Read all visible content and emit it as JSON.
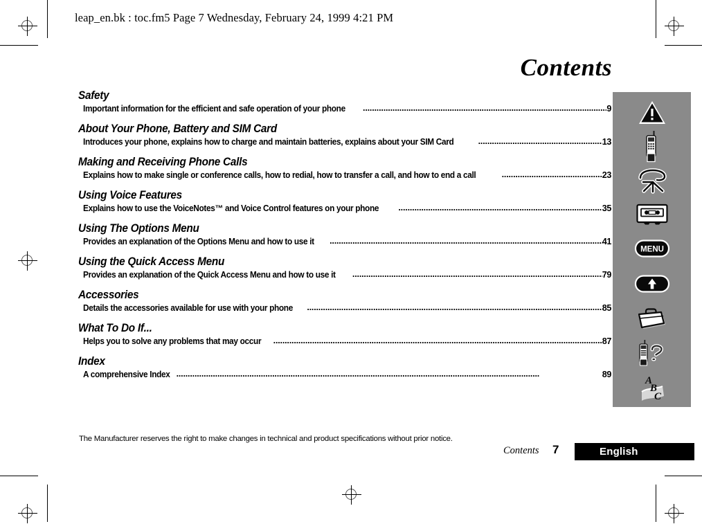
{
  "file_header": "leap_en.bk : toc.fm5  Page 7  Wednesday, February 24, 1999  4:21 PM",
  "page_title": "Contents",
  "toc": {
    "entries": [
      {
        "heading": "Safety",
        "description": "Important information for the efficient and safe operation of your phone",
        "page": "9"
      },
      {
        "heading": "About Your Phone, Battery and SIM Card",
        "description": "Introduces your phone, explains how to charge and maintain batteries, explains about your SIM Card",
        "page": "13"
      },
      {
        "heading": "Making and Receiving Phone Calls",
        "description": "Explains how to make single or conference calls, how to redial, how to transfer a call, and how to end a call",
        "page": "23"
      },
      {
        "heading": "Using Voice Features",
        "description": "Explains how to use the VoiceNotes™ and Voice Control features on your phone",
        "page": "35"
      },
      {
        "heading": "Using The Options Menu",
        "description": "Provides an explanation of the Options Menu and how to use it",
        "page": "41"
      },
      {
        "heading": "Using the Quick Access Menu",
        "description": "Provides an explanation of the Quick Access Menu and how to use it",
        "page": "79"
      },
      {
        "heading": "Accessories",
        "description": "Details the accessories available for use with your phone",
        "page": "85"
      },
      {
        "heading": "What To Do If...",
        "description": "Helps you to solve any problems that may occur",
        "page": "87"
      },
      {
        "heading": "Index",
        "description": "A comprehensive Index",
        "page": "89"
      }
    ]
  },
  "icon_panel": {
    "background_color": "#8a8a8a",
    "icons": [
      {
        "name": "warning-triangle-icon",
        "label": ""
      },
      {
        "name": "mobile-phone-icon",
        "label": ""
      },
      {
        "name": "telephone-handset-icon",
        "label": ""
      },
      {
        "name": "cassette-tape-icon",
        "label": ""
      },
      {
        "name": "menu-button-icon",
        "label": "MENU"
      },
      {
        "name": "up-arrow-button-icon",
        "label": ""
      },
      {
        "name": "briefcase-icon",
        "label": ""
      },
      {
        "name": "phone-question-icon",
        "label": ""
      },
      {
        "name": "abc-index-icon",
        "label": "ABC"
      }
    ]
  },
  "footer": {
    "disclaimer": "The Manufacturer reserves the right to make changes in technical and product specifications without prior notice.",
    "section": "Contents",
    "page_number": "7",
    "language": "English",
    "bar_color": "#000000"
  }
}
